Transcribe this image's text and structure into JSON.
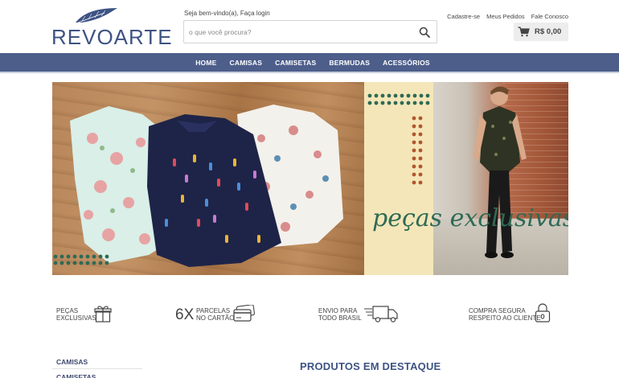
{
  "brand": {
    "logo_text": "REVOARTE",
    "accent": "#3e5384",
    "nav_bg": "#4d5e8b"
  },
  "header": {
    "welcome_text": "Seja bem-vindo(a),",
    "login_text": "Faça login",
    "search": {
      "placeholder": "o que você procura?",
      "value": "",
      "icon": "search-icon"
    },
    "top_links": [
      "Cadastre-se",
      "Meus Pedidos",
      "Fale Conosco"
    ],
    "cart": {
      "icon": "cart-icon",
      "total": "R$ 0,00"
    }
  },
  "nav": {
    "items": [
      "HOME",
      "CAMISAS",
      "CAMISETAS",
      "BERMUDAS",
      "ACESSÓRIOS"
    ]
  },
  "banner": {
    "tagline": "peças exclusivas"
  },
  "features": [
    {
      "line1": "PEÇAS",
      "line2": "EXCLUSIVAS",
      "icon": "gift-icon"
    },
    {
      "big": "6X",
      "line1": "PARCELAS",
      "line2": "NO CARTÃO",
      "icon": "credit-card-icon"
    },
    {
      "line1": "ENVIO PARA",
      "line2": "TODO BRASIL",
      "icon": "truck-icon"
    },
    {
      "line1": "COMPRA SEGURA",
      "line2": "RESPEITO AO CLIENTE",
      "icon": "lock-icon"
    }
  ],
  "sidebar": {
    "items": [
      "CAMISAS",
      "CAMISETAS"
    ]
  },
  "main": {
    "section_title": "PRODUTOS EM DESTAQUE"
  }
}
